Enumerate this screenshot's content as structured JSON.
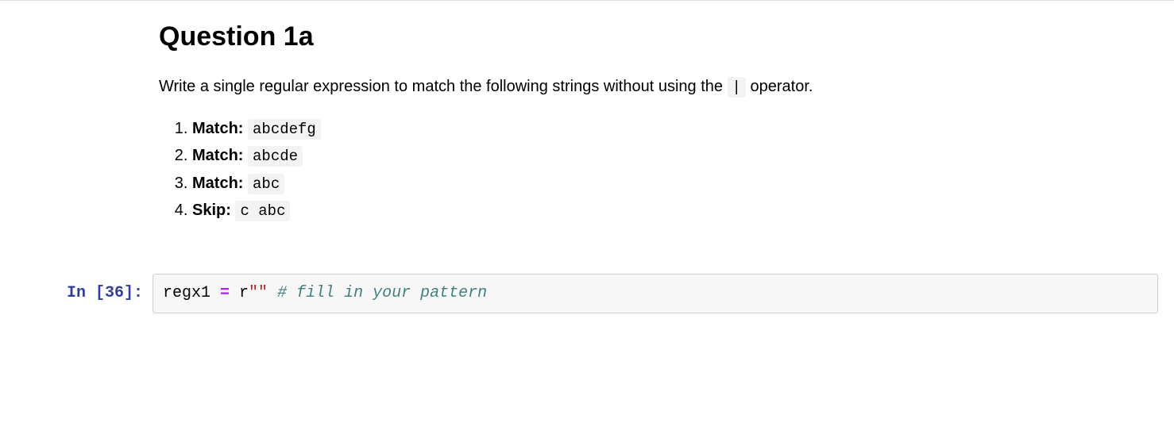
{
  "markdown": {
    "heading": "Question 1a",
    "paragraph_pre": "Write a single regular expression to match the following strings without using the ",
    "paragraph_code": "|",
    "paragraph_post": " operator.",
    "items": [
      {
        "label": "Match:",
        "value": "abcdefg"
      },
      {
        "label": "Match:",
        "value": "abcde"
      },
      {
        "label": "Match:",
        "value": "abc"
      },
      {
        "label": "Skip:",
        "value": "c abc"
      }
    ]
  },
  "code": {
    "prompt": "In [36]:",
    "var": "regx1",
    "eq": " = ",
    "str_prefix": "r",
    "str_body": "\"\"",
    "comment": " # fill in your pattern"
  }
}
